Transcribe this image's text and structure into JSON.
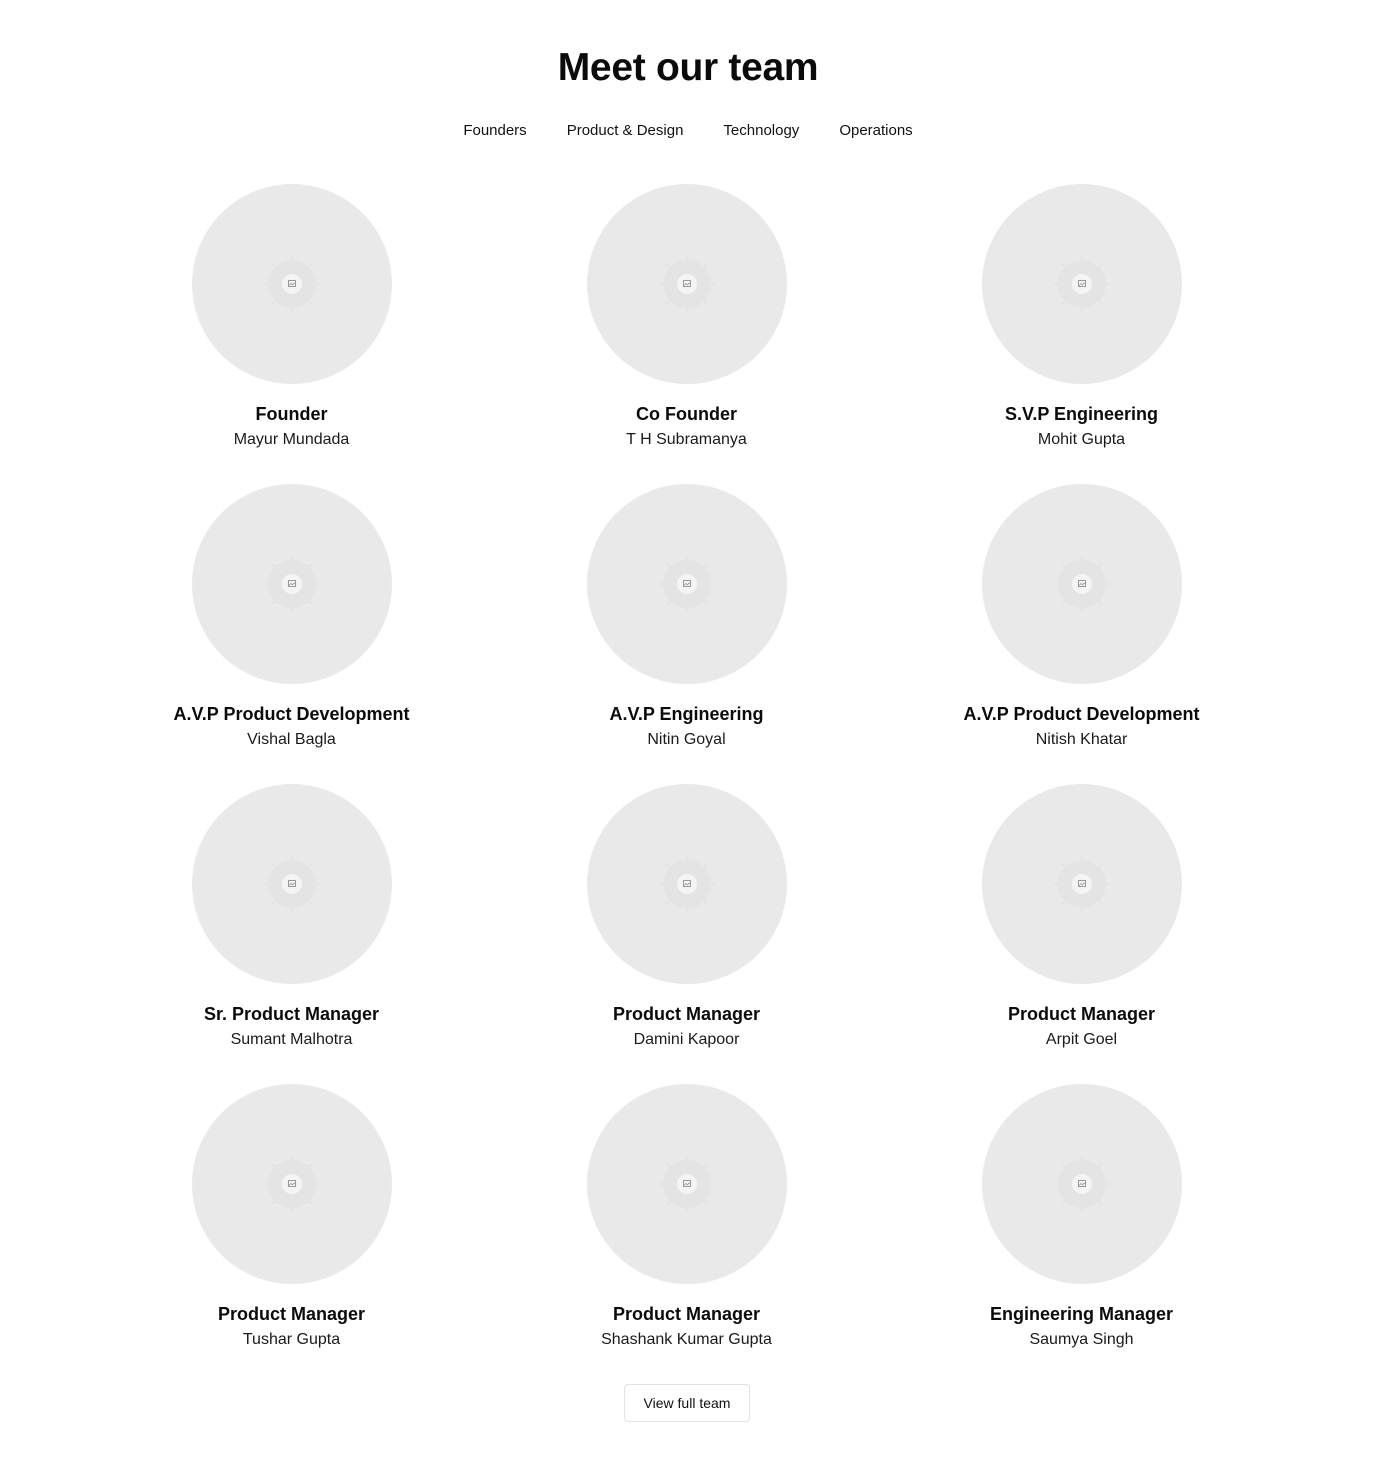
{
  "header": {
    "title": "Meet our team"
  },
  "tabs": [
    {
      "label": "Founders"
    },
    {
      "label": "Product & Design"
    },
    {
      "label": "Technology"
    },
    {
      "label": "Operations"
    }
  ],
  "team": [
    {
      "role": "Founder",
      "name": "Mayur Mundada",
      "icon": "image-placeholder-icon"
    },
    {
      "role": "Co Founder",
      "name": "T H Subramanya",
      "icon": "image-placeholder-icon"
    },
    {
      "role": "S.V.P Engineering",
      "name": "Mohit Gupta",
      "icon": "image-placeholder-icon"
    },
    {
      "role": "A.V.P Product Development",
      "name": "Vishal Bagla",
      "icon": "image-placeholder-icon"
    },
    {
      "role": "A.V.P Engineering",
      "name": "Nitin Goyal",
      "icon": "image-placeholder-icon"
    },
    {
      "role": "A.V.P Product Development",
      "name": "Nitish Khatar",
      "icon": "image-placeholder-icon"
    },
    {
      "role": "Sr. Product Manager",
      "name": "Sumant Malhotra",
      "icon": "image-placeholder-icon"
    },
    {
      "role": "Product Manager",
      "name": "Damini Kapoor",
      "icon": "image-placeholder-icon"
    },
    {
      "role": "Product Manager",
      "name": "Arpit Goel",
      "icon": "image-placeholder-icon"
    },
    {
      "role": "Product Manager",
      "name": "Tushar Gupta",
      "icon": "image-placeholder-icon"
    },
    {
      "role": "Product Manager",
      "name": "Shashank Kumar Gupta",
      "icon": "image-placeholder-icon"
    },
    {
      "role": "Engineering Manager",
      "name": "Saumya Singh",
      "icon": "image-placeholder-icon"
    }
  ],
  "footer": {
    "view_full_team_label": "View full team"
  },
  "colors": {
    "avatar_bg": "#e9e9e9",
    "text": "#0b0b0b",
    "button_border": "#e2e2e2"
  }
}
